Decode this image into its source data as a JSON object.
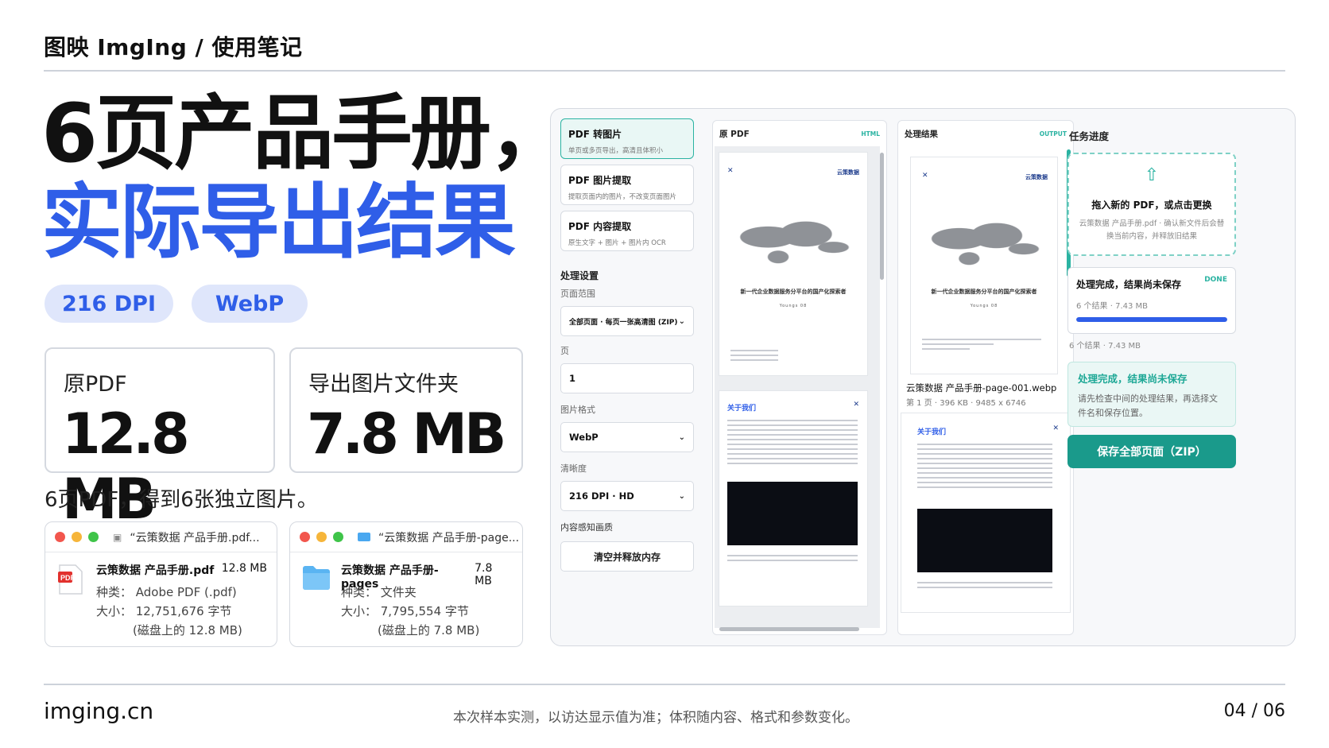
{
  "brand": "图映 ImgIng / 使用笔记",
  "hero": {
    "line1": "6页产品手册，",
    "line2": "实际导出结果"
  },
  "pills": [
    "216 DPI",
    "WebP"
  ],
  "stats": [
    {
      "label": "原PDF",
      "value": "12.8 MB"
    },
    {
      "label": "导出图片文件夹",
      "value": "7.8 MB"
    }
  ],
  "note": "6页PDF，得到6张独立图片。",
  "finders": [
    {
      "title": "“云策数据 产品手册.pdf...",
      "name": "云策数据 产品手册.pdf",
      "size": "12.8 MB",
      "kind": "种类：  Adobe PDF (.pdf)",
      "bytes": "大小：  12,751,676 字节",
      "disk": "(磁盘上的 12.8 MB)"
    },
    {
      "title": "“云策数据 产品手册-page...",
      "name": "云策数据 产品手册-pages",
      "size": "7.8 MB",
      "kind": "种类：  文件夹",
      "bytes": "大小：  7,795,554 字节",
      "disk": "(磁盘上的 7.8 MB)"
    }
  ],
  "footer": {
    "site": "imging.cn",
    "disclaimer": "本次样本实测，以访达显示值为准；体积随内容、格式和参数变化。",
    "page": "04 / 06"
  },
  "app": {
    "modes": [
      {
        "title": "PDF 转图片",
        "desc": "单页或多页导出，高清且体积小"
      },
      {
        "title": "PDF 图片提取",
        "desc": "提取页面内的图片，不改变页面图片"
      },
      {
        "title": "PDF 内容提取",
        "desc": "原生文字 + 图片 + 图片内 OCR"
      }
    ],
    "settings_title": "处理设置",
    "range_label": "页面范围",
    "range_value": "全部页面 · 每页一张高清图 (ZIP)",
    "page_label": "页",
    "page_value": "1",
    "format_label": "图片格式",
    "format_value": "WebP",
    "quality_label": "清晰度",
    "quality_value": "216 DPI · HD",
    "aware_label": "内容感知画质",
    "clear_button": "清空并释放内存",
    "original_title": "原 PDF",
    "original_tag": "HTML",
    "result_title": "处理结果",
    "result_tag": "OUTPUT",
    "doc": {
      "brand": "云策数据",
      "cover_title": "新一代企业数据服务分平台的国产化探索者",
      "cover_sub": "Youngs 08",
      "about": "关于我们"
    },
    "result_file": "云策数据 产品手册-page-001.webp",
    "result_info": "第 1 页 · 396 KB · 9485 x 6746",
    "progress_title": "任务进度",
    "drop_main": "拖入新的 PDF，或点击更换",
    "drop_sub": "云策数据 产品手册.pdf · 确认新文件后会替换当前内容，并释放旧结果",
    "done_title": "处理完成，结果尚未保存",
    "done_tag": "DONE",
    "done_sub": "6 个结果 · 7.43 MB",
    "done_progress": 1.0,
    "count_meta": "6 个结果 · 7.43 MB",
    "info_title": "处理完成，结果尚未保存",
    "info_body": "请先检查中间的处理结果，再选择文件名和保存位置。",
    "save_button": "保存全部页面（ZIP）"
  },
  "colors": {
    "accent_blue": "#2f5ee8",
    "accent_teal": "#1a9a8b"
  }
}
